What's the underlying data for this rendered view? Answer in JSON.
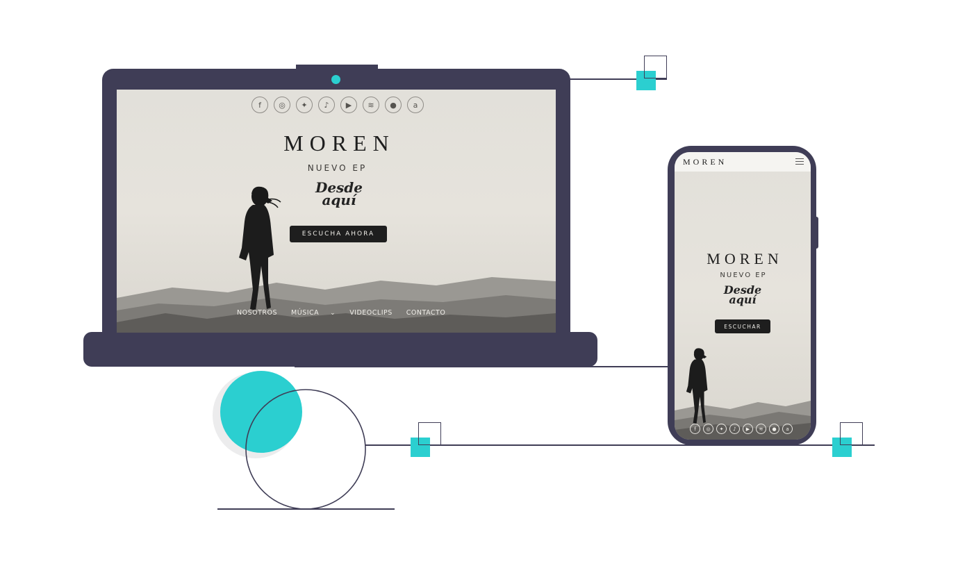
{
  "site": {
    "brand": "MOREN",
    "subtitle": "NUEVO EP",
    "ep_title_line1": "Desde",
    "ep_title_line2": "aquí",
    "cta_desktop": "ESCUCHA AHORA",
    "cta_mobile": "ESCUCHAR",
    "nav": {
      "nosotros": "NOSOTROS",
      "musica": "MÚSICA",
      "chevron": "⌄",
      "videoclips": "VIDEOCLIPS",
      "contacto": "CONTACTO"
    },
    "social_icons": [
      "facebook-icon",
      "instagram-icon",
      "twitter-icon",
      "tiktok-icon",
      "youtube-icon",
      "spotify-icon",
      "apple-music-icon",
      "amazon-music-icon"
    ],
    "social_glyphs": {
      "facebook": "f",
      "instagram": "◎",
      "twitter": "✦",
      "tiktok": "♪",
      "youtube": "▶",
      "spotify": "≋",
      "apple": "●",
      "amazon": "a"
    }
  },
  "colors": {
    "device": "#3f3d56",
    "accent": "#2bcfd0",
    "screen_bg": "#e3e0d9",
    "button_bg": "#1e1e1e"
  }
}
